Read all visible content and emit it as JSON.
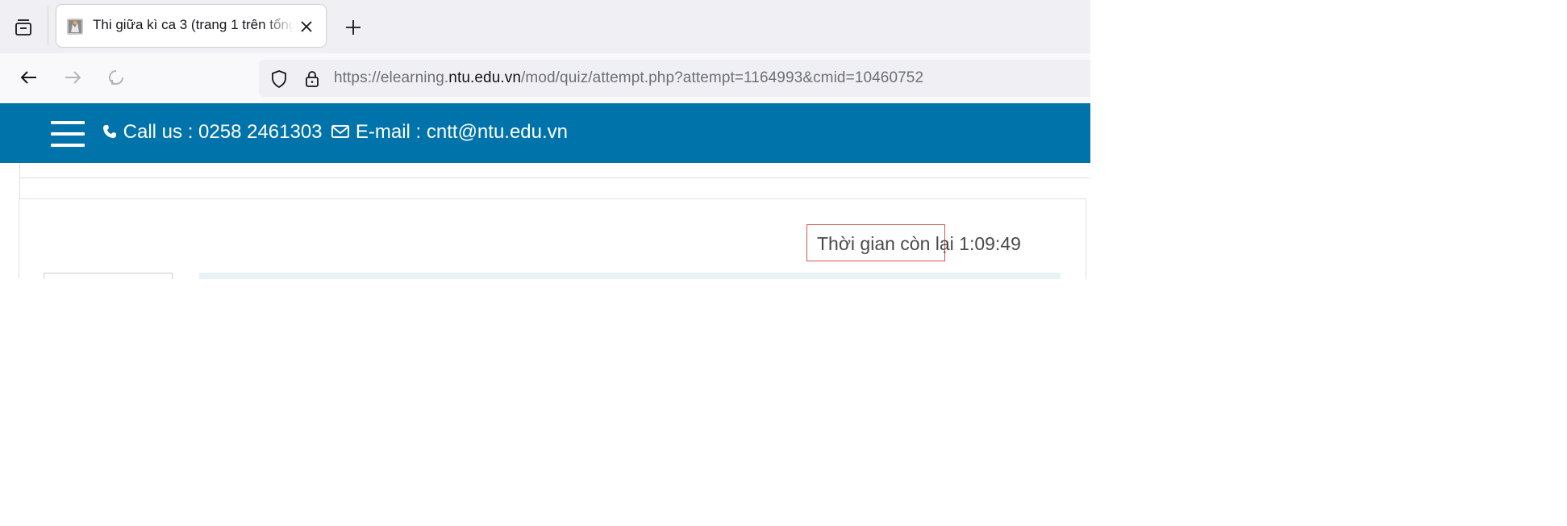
{
  "browser": {
    "tab": {
      "title": "Thi giữa kì ca 3 (trang 1 trên tổng số",
      "favicon_icon": "moodle-favicon-icon",
      "close_icon": "close-icon"
    },
    "new_tab_icon": "plus-icon",
    "tab_list_icon": "tab-list-icon",
    "nav": {
      "back_icon": "arrow-left-icon",
      "forward_icon": "arrow-right-icon",
      "reload_icon": "reload-icon"
    },
    "url": {
      "prefix": "https://elearning.",
      "host": "ntu.edu.vn",
      "path": "/mod/quiz/attempt.php?attempt=1164993&cmid=10460752"
    },
    "shield_icon": "shield-icon",
    "lock_icon": "lock-icon"
  },
  "site_header": {
    "menu_icon": "hamburger-menu-icon",
    "phone_icon": "phone-icon",
    "call_label": "Call us : 0258 2461303",
    "mail_icon": "envelope-icon",
    "email_label": "E-mail : cntt@ntu.edu.vn"
  },
  "quiz": {
    "timer_text": "Thời gian còn lại 1:09:49"
  },
  "colors": {
    "header_blue": "#0073aa",
    "timer_border": "#d9534f",
    "question_bg": "#e7f3f5"
  }
}
